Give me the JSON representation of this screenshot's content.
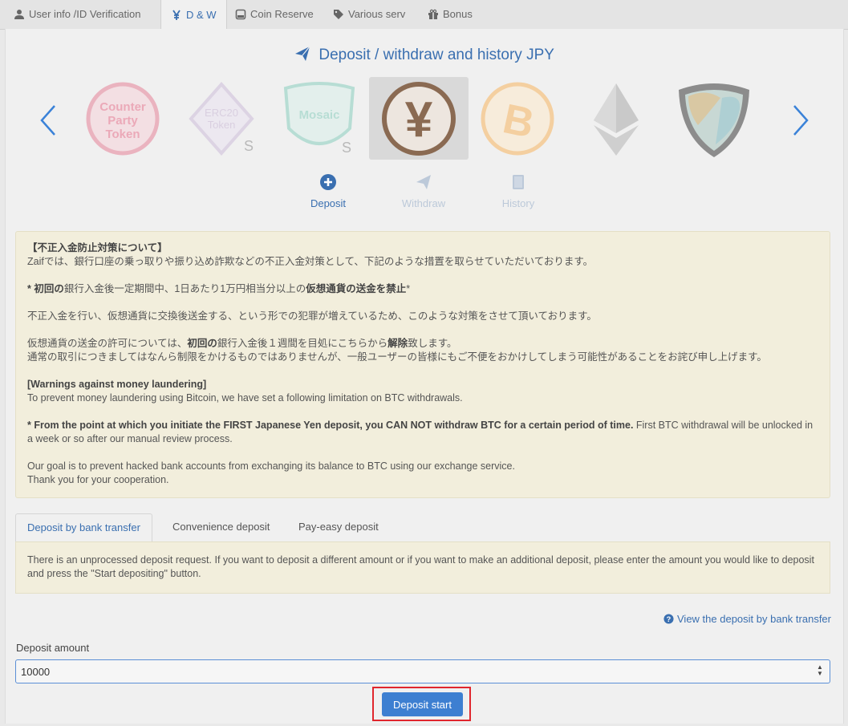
{
  "nav": {
    "tabs": [
      {
        "label": "User info /ID Verification",
        "icon": "user-icon"
      },
      {
        "label": "D & W",
        "icon": "yen-icon"
      },
      {
        "label": "Coin Reserve",
        "icon": "reserve-icon"
      },
      {
        "label": "Various serv",
        "icon": "tags-icon"
      },
      {
        "label": "Bonus",
        "icon": "gift-icon"
      }
    ],
    "active": "D & W"
  },
  "page": {
    "title": "Deposit / withdraw and history JPY",
    "coins": [
      {
        "name": "Counter Party Token",
        "label_lines": [
          "Counter",
          "Party",
          "Token"
        ]
      },
      {
        "name": "ERC20 Token",
        "label_lines": [
          "ERC20",
          "Token"
        ]
      },
      {
        "name": "Mosaic",
        "label_lines": [
          "Mosaic"
        ]
      },
      {
        "name": "JPY",
        "symbol": "¥",
        "selected": true
      },
      {
        "name": "Bitcoin",
        "symbol": "B"
      },
      {
        "name": "Ethereum"
      },
      {
        "name": "NEM"
      }
    ],
    "actions": [
      {
        "label": "Deposit",
        "active": true
      },
      {
        "label": "Withdraw",
        "active": false
      },
      {
        "label": "History",
        "active": false
      }
    ]
  },
  "notice": {
    "jp_title": "【不正入金防止対策について】",
    "jp_line1": "Zaifでは、銀行口座の乗っ取りや振り込め詐欺などの不正入金対策として、下記のような措置を取らせていただいております。",
    "jp_line2_a": "* ",
    "jp_line2_b": "初回の",
    "jp_line2_c": "銀行入金後一定期間中、1日あたり1万円相当分以上の",
    "jp_line2_d": "仮想通貨の送金を禁止",
    "jp_line2_e": "*",
    "jp_line3": "不正入金を行い、仮想通貨に交換後送金する、という形での犯罪が増えているため、このような対策をさせて頂いております。",
    "jp_line4_a": "仮想通貨の送金の許可については、",
    "jp_line4_b": "初回の",
    "jp_line4_c": "銀行入金後１週間を目処にこちらから",
    "jp_line4_d": "解除",
    "jp_line4_e": "致します。",
    "jp_line5": "通常の取引につきましてはなんら制限をかけるものではありませんが、一般ユーザーの皆様にもご不便をおかけしてしまう可能性があることをお詫び申し上げます。",
    "en_title": "[Warnings against money laundering]",
    "en_line1": "To prevent money laundering using Bitcoin, we have set a following limitation on BTC withdrawals.",
    "en_bold": "* From the point at which you initiate the FIRST Japanese Yen deposit, you CAN NOT withdraw BTC for a certain period of time.",
    "en_line2": " First BTC withdrawal will be unlocked in a week or so after our manual review process.",
    "en_line3": "Our goal is to prevent hacked bank accounts from exchanging its balance to BTC using our exchange service.",
    "en_line4": "Thank you for your cooperation."
  },
  "deposit_tabs": [
    {
      "label": "Deposit by bank transfer",
      "active": true
    },
    {
      "label": "Convenience deposit",
      "active": false
    },
    {
      "label": "Pay-easy deposit",
      "active": false
    }
  ],
  "info_text": "There is an unprocessed deposit request. If you want to deposit a different amount or if you want to make an additional deposit, please enter the amount you would like to deposit and press the \"Start depositing\" button.",
  "view_link": "View the deposit by bank transfer",
  "form": {
    "amount_label": "Deposit amount",
    "amount_value": "10000",
    "submit_label": "Deposit start"
  },
  "colors": {
    "accent": "#3a6fb0",
    "button": "#3d7fd1",
    "notice_bg": "#f2eedc",
    "highlight": "#e0262d"
  }
}
